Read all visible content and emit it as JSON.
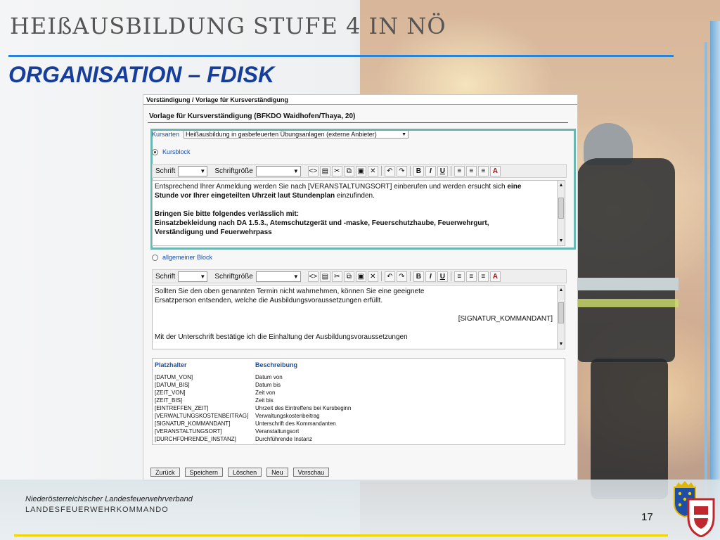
{
  "slide": {
    "title": "HEIßAUSBILDUNG STUFE 4 IN NÖ",
    "subtitle": "ORGANISATION – FDISK"
  },
  "screenshot": {
    "header": "Verständigung / Vorlage für Kursverständigung",
    "form_title": "Vorlage für Kursverständigung (BFKDO Waidhofen/Thaya, 20)",
    "kursarten_label": "Kursarten",
    "kursarten_value": "Heißausbildung in gasbefeuerten Übungsanlagen (externe Anbieter)",
    "radio_kursblock": "Kursblock",
    "radio_allgemein": "allgemeiner Block",
    "toolbar": {
      "font_label": "Schrift",
      "size_label": "Schriftgröße"
    },
    "editor1": {
      "line1_a": "Entsprechend Ihrer Anmeldung werden Sie nach [VERANSTALTUNGSORT] einberufen und werden ersucht sich ",
      "line1_b": "eine",
      "line2_a": "Stunde vor Ihrer eingeteilten Uhrzeit laut Stundenplan",
      "line2_b": " einzufinden.",
      "line3": "Bringen Sie bitte folgendes verlässlich mit:",
      "line4": "Einsatzbekleidung nach DA 1.5.3., Atemschutzgerät und -maske, Feuerschutzhaube, Feuerwehrgurt,",
      "line5": "Verständigung und Feuerwehrpass"
    },
    "editor2": {
      "line1": "Sollten Sie den oben genannten Termin nicht wahrnehmen, können Sie eine geeignete",
      "line2": "Ersatzperson entsenden, welche die Ausbildungsvoraussetzungen erfüllt.",
      "signature": "[SIGNATUR_KOMMANDANT]",
      "line3": "Mit der Unterschrift bestätige ich die Einhaltung der Ausbildungsvoraussetzungen"
    },
    "placeholders": {
      "col1": "Platzhalter",
      "col2": "Beschreibung",
      "rows": [
        {
          "key": "[DATUM_VON]",
          "desc": "Datum von"
        },
        {
          "key": "[DATUM_BIS]",
          "desc": "Datum bis"
        },
        {
          "key": "[ZEIT_VON]",
          "desc": "Zeit von"
        },
        {
          "key": "[ZEIT_BIS]",
          "desc": "Zeit bis"
        },
        {
          "key": "[EINTREFFEN_ZEIT]",
          "desc": "Uhrzeit des Eintreffens bei Kursbeginn"
        },
        {
          "key": "[VERWALTUNGSKOSTENBEITRAG]",
          "desc": "Verwaltungskostenbeitrag"
        },
        {
          "key": "[SIGNATUR_KOMMANDANT]",
          "desc": "Unterschrift des Kommandanten"
        },
        {
          "key": "[VERANSTALTUNGSORT]",
          "desc": "Veranstaltungsort"
        },
        {
          "key": "[DURCHFÜHRENDE_INSTANZ]",
          "desc": "Durchführende Instanz"
        }
      ]
    },
    "buttons": [
      "Zurück",
      "Speichern",
      "Löschen",
      "Neu",
      "Vorschau"
    ]
  },
  "footer": {
    "line1": "Niederösterreichischer Landesfeuerwehrverband",
    "line2": "LANDESFEUERWEHRKOMMANDO",
    "page_number": "17"
  },
  "colors": {
    "title_blue": "#163e9c",
    "rule_blue": "#2a84d6",
    "frame_teal": "#6ab7b2",
    "footer_yellow": "#f3d400"
  }
}
